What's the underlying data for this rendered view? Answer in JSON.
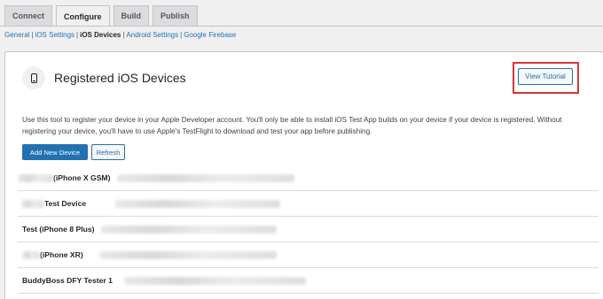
{
  "tabs": [
    {
      "label": "Connect",
      "active": false
    },
    {
      "label": "Configure",
      "active": true
    },
    {
      "label": "Build",
      "active": false
    },
    {
      "label": "Publish",
      "active": false
    }
  ],
  "subnav": {
    "items": [
      "General",
      "iOS Settings",
      "iOS Devices",
      "Android Settings",
      "Google Firebase"
    ],
    "current": "iOS Devices"
  },
  "card": {
    "title": "Registered iOS Devices",
    "icon": "iphone-icon",
    "tutorial_label": "View Tutorial",
    "description": "Use this tool to register your device in your Apple Developer account. You'll only be able to install iOS Test App builds on your device if your device is registered. Without registering your device, you'll have to use Apple's TestFlight to download and test your app before publishing.",
    "add_label": "Add New Device",
    "refresh_label": "Refresh"
  },
  "devices": [
    {
      "name": "(iPhone X GSM)"
    },
    {
      "name": "Test Device"
    },
    {
      "name": "Test (iPhone 8 Plus)"
    },
    {
      "name": "(iPhone XR)"
    },
    {
      "name": "BuddyBoss DFY Tester 1"
    }
  ],
  "colors": {
    "accent": "#2271b1",
    "highlight": "#d63638",
    "background": "#f0f0f1"
  }
}
